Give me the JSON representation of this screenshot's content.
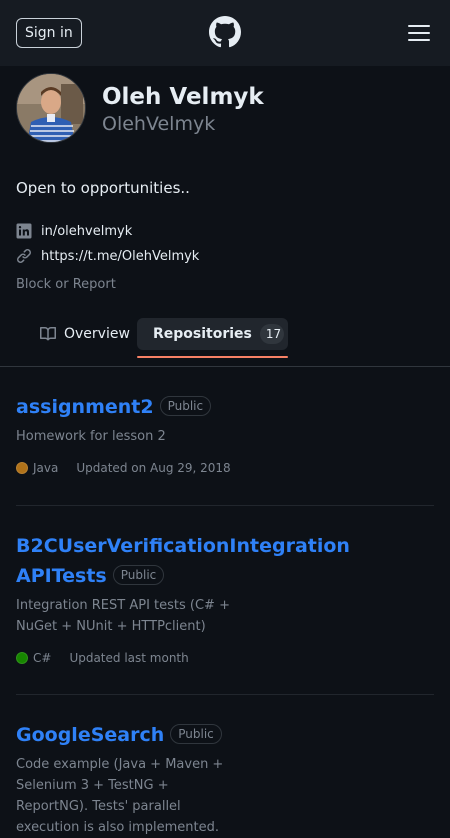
{
  "header": {
    "sign_in_label": "Sign in",
    "logo_icon": "github-mark-icon",
    "menu_icon": "hamburger-icon"
  },
  "profile": {
    "full_name": "Oleh Velmyk",
    "username": "OlehVelmyk",
    "bio": "Open to opportunities..",
    "linkedin": "in/olehvelmyk",
    "website": "https://t.me/OlehVelmyk",
    "block_report": "Block or Report"
  },
  "tabs": {
    "overview_label": "Overview",
    "repositories_label": "Repositories",
    "repositories_count": "17"
  },
  "repos": [
    {
      "name": "assignment2",
      "visibility": "Public",
      "description": "Homework for lesson 2",
      "language": "Java",
      "language_color": "#b07219",
      "updated": "Updated on Aug 29, 2018"
    },
    {
      "name": "B2CUserVerificationIntegrationAPITests",
      "visibility": "Public",
      "description": "Integration REST API tests (C# + NuGet + NUnit + HTTPclient)",
      "language": "C#",
      "language_color": "#178600",
      "updated": "Updated last month"
    },
    {
      "name": "GoogleSearch",
      "visibility": "Public",
      "description": "Code example (Java + Maven + Selenium 3 + TestNG + ReportNG). Tests' parallel execution is also implemented."
    }
  ],
  "colors": {
    "background": "#0d1117",
    "header": "#161b22",
    "link": "#2f81f7",
    "muted": "#7d8590",
    "tab_accent": "#f78166"
  }
}
